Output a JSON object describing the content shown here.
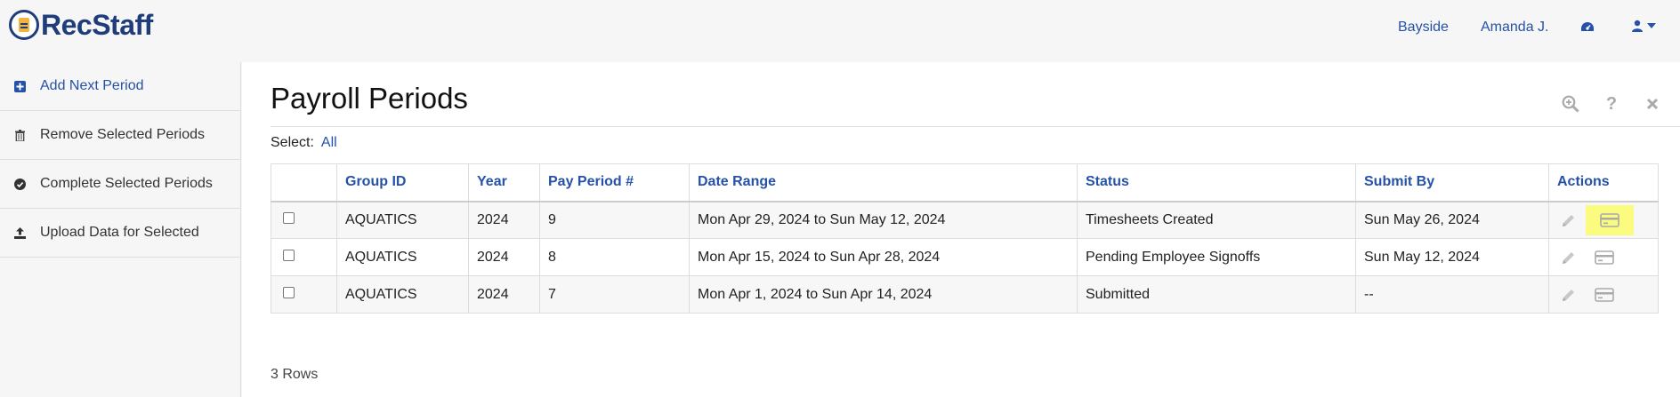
{
  "app": {
    "logo_text": "RecStaff"
  },
  "topnav": {
    "location": "Bayside",
    "user": "Amanda J.",
    "dashboard_icon": "dashboard-icon",
    "account_icon": "user-icon"
  },
  "sidebar": {
    "items": [
      {
        "label": "Add Next Period",
        "icon": "plus-square-icon",
        "active": true
      },
      {
        "label": "Remove Selected Periods",
        "icon": "trash-icon"
      },
      {
        "label": "Complete Selected Periods",
        "icon": "check-circle-icon"
      },
      {
        "label": "Upload Data for Selected",
        "icon": "upload-icon"
      }
    ]
  },
  "page": {
    "title": "Payroll Periods",
    "select_label": "Select:",
    "select_all": "All",
    "row_count": "3 Rows",
    "tools": [
      "zoom-icon",
      "help-icon",
      "close-icon"
    ]
  },
  "table": {
    "headers": [
      "",
      "Group ID",
      "Year",
      "Pay Period #",
      "Date Range",
      "Status",
      "Submit By",
      "Actions"
    ],
    "rows": [
      {
        "group": "AQUATICS",
        "year": "2024",
        "period": "9",
        "range": "Mon Apr 29, 2024 to Sun May 12, 2024",
        "status": "Timesheets Created",
        "submit_by": "Sun May 26, 2024"
      },
      {
        "group": "AQUATICS",
        "year": "2024",
        "period": "8",
        "range": "Mon Apr 15, 2024 to Sun Apr 28, 2024",
        "status": "Pending Employee Signoffs",
        "submit_by": "Sun May 12, 2024"
      },
      {
        "group": "AQUATICS",
        "year": "2024",
        "period": "7",
        "range": "Mon Apr 1, 2024 to Sun Apr 14, 2024",
        "status": "Submitted",
        "submit_by": "--"
      }
    ]
  },
  "colors": {
    "accent": "#2552a8",
    "brand": "#1f3d7a",
    "highlight": "#fbfb80"
  }
}
